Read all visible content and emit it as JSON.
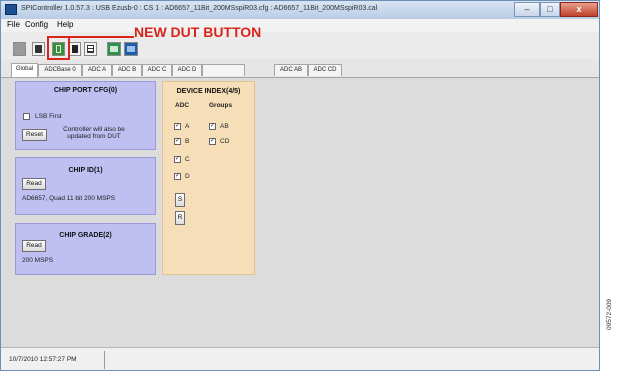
{
  "window": {
    "title": "SPIController 1.0.57.3 : USB Ezusb-0 : CS 1 : AD6657_11Bit_200MSspiR03.cfg : AD6657_11Bit_200MSspiR03.cal",
    "minimize": "–",
    "maximize": "□",
    "close": "x"
  },
  "menu": {
    "file": "File",
    "config": "Config",
    "help": "Help"
  },
  "annotation": {
    "label": "NEW DUT BUTTON",
    "color": "#d9261c"
  },
  "toolbar": {
    "icons": [
      "disabled-icon",
      "save-icon",
      "new-dut-icon",
      "copy-icon",
      "grid-icon",
      "chart-icon",
      "window-icon"
    ]
  },
  "tabs": [
    "Global",
    "ADCBase 0",
    "ADC A",
    "ADC B",
    "ADC C",
    "ADC D",
    "",
    "ADC AB",
    "ADC CD"
  ],
  "chip_port": {
    "title": "CHIP PORT CFG(0)",
    "lsb_label": "LSB First",
    "reset_label": "Reset",
    "note": "Controller will also be updated from DUT"
  },
  "chip_id": {
    "title": "CHIP ID(1)",
    "read_label": "Read",
    "value": "AD6657, Quad 11 bit 200 MSPS"
  },
  "chip_grade": {
    "title": "CHIP GRADE(2)",
    "read_label": "Read",
    "value": "200 MSPS"
  },
  "device_index": {
    "title": "DEVICE INDEX(4/5)",
    "adc_header": "ADC",
    "groups_header": "Groups",
    "adc": [
      "A",
      "B",
      "C",
      "D"
    ],
    "groups": [
      "AB",
      "CD"
    ],
    "s_label": "S",
    "r_label": "R"
  },
  "status": {
    "timestamp": "10/7/2010 12:57:27 PM"
  },
  "figure_id": "09572-009"
}
